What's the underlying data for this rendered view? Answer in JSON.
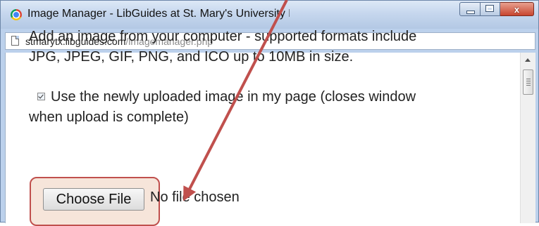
{
  "window": {
    "title": "Image Manager - LibGuides at St. Mary's University Blume Library -...",
    "close_symbol": "x",
    "buttons": [
      "minimize",
      "maximize",
      "close"
    ]
  },
  "address_bar": {
    "host": "stmarytx.libguides.com",
    "path": "/imagemanager.php"
  },
  "content": {
    "intro_line1": "Add an image from your computer - supported formats include",
    "intro_line2": "JPG, JPEG, GIF, PNG, and ICO up to 10MB in size.",
    "checkbox_checked": true,
    "checkbox_label_line1": "Use the newly uploaded image in my page (closes window",
    "checkbox_label_line2": "when upload is complete)",
    "choose_file_label": "Choose File",
    "no_file_text": "No file chosen"
  },
  "annotation": {
    "color": "#c0504d",
    "type": "arrow-and-highlight"
  },
  "icons": {
    "title": "chrome-icon",
    "address": "page-icon",
    "scroll_up": "scroll-up-icon"
  }
}
